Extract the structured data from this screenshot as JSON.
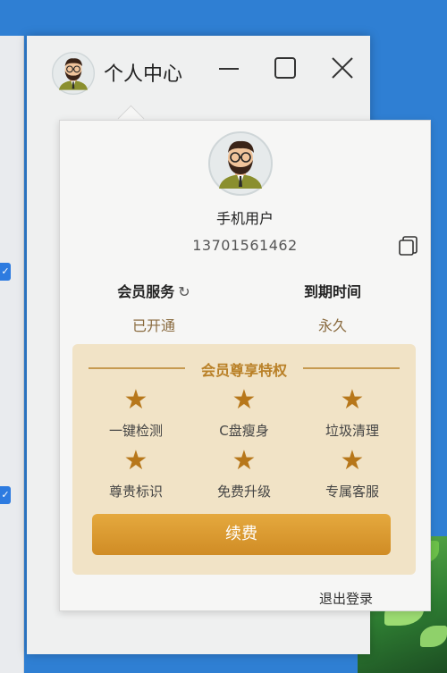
{
  "window": {
    "title": "个人中心"
  },
  "user": {
    "name": "手机用户",
    "phone": "13701561462"
  },
  "membership": {
    "service_label": "会员服务",
    "service_value": "已开通",
    "expiry_label": "到期时间",
    "expiry_value": "永久"
  },
  "benefits": {
    "title": "会员尊享特权",
    "items": [
      {
        "label": "一键检测",
        "icon": "star-icon"
      },
      {
        "label": "C盘瘦身",
        "icon": "star-icon"
      },
      {
        "label": "垃圾清理",
        "icon": "star-icon"
      },
      {
        "label": "尊贵标识",
        "icon": "star-icon"
      },
      {
        "label": "免费升级",
        "icon": "star-icon"
      },
      {
        "label": "专属客服",
        "icon": "star-icon"
      }
    ],
    "renew_label": "续费"
  },
  "logout_label": "退出登录",
  "colors": {
    "accent_gold": "#d08c25",
    "benefit_bg": "#f1e3c6",
    "star": "#b7771a"
  }
}
